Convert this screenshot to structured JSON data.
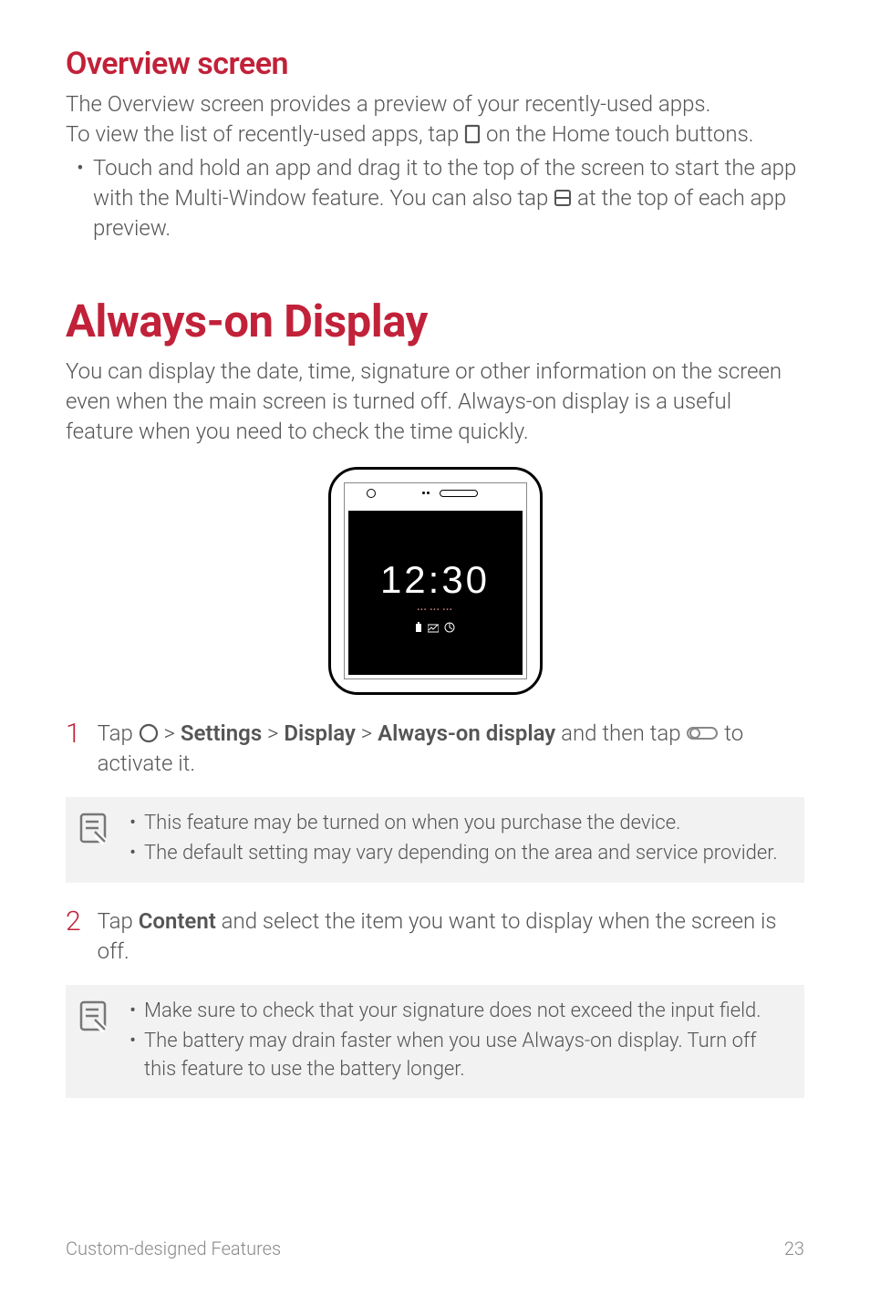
{
  "sections": {
    "overview": {
      "heading": "Overview screen",
      "intro": "The Overview screen provides a preview of your recently-used apps.",
      "instruction_prefix": "To view the list of recently-used apps, tap ",
      "instruction_suffix": " on the Home touch buttons.",
      "bullet_prefix": "Touch and hold an app and drag it to the top of the screen to start the app with the Multi-Window feature. You can also tap ",
      "bullet_suffix": " at the top of each app preview."
    },
    "always_on": {
      "heading": "Always-on Display",
      "intro": "You can display the date, time, signature or other information on the screen even when the main screen is turned off. Always-on display is a useful feature when you need to check the time quickly.",
      "phone": {
        "clock": "12:30",
        "subtext": "••• ••• •••"
      },
      "steps": [
        {
          "num": "1",
          "tap_prefix": "Tap ",
          "separator": " > ",
          "path": [
            "Settings",
            "Display",
            "Always-on display"
          ],
          "suffix_before_toggle": " and then tap ",
          "suffix_after_toggle": " to activate it."
        },
        {
          "num": "2",
          "tap_prefix": "Tap ",
          "content_label": "Content",
          "suffix": " and select the item you want to display when the screen is off."
        }
      ],
      "notes": [
        {
          "items": [
            "This feature may be turned on when you purchase the device.",
            "The default setting may vary depending on the area and service provider."
          ]
        },
        {
          "items": [
            "Make sure to check that your signature does not exceed the input field.",
            "The battery may drain faster when you use Always-on display. Turn off this feature to use the battery longer."
          ]
        }
      ]
    }
  },
  "footer": {
    "section_label": "Custom-designed Features",
    "page_number": "23"
  }
}
